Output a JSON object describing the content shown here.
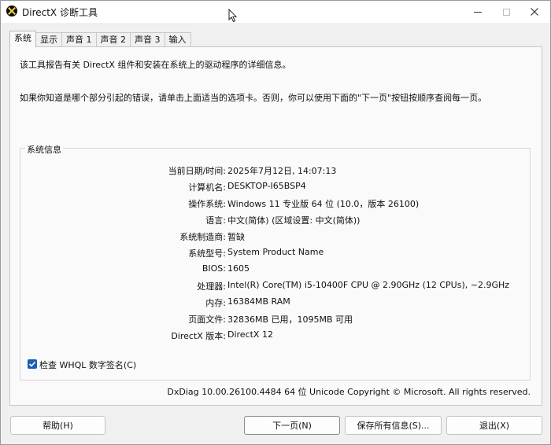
{
  "window": {
    "title": "DirectX 诊断工具"
  },
  "tabs": [
    {
      "label": "系统",
      "active": true
    },
    {
      "label": "显示"
    },
    {
      "label": "声音 1"
    },
    {
      "label": "声音 2"
    },
    {
      "label": "声音 3"
    },
    {
      "label": "输入"
    }
  ],
  "panel": {
    "intro_line1": "该工具报告有关 DirectX 组件和安装在系统上的驱动程序的详细信息。",
    "intro_line2": "如果你知道是哪个部分引起的错误，请单击上面适当的选项卡。否则，你可以使用下面的\"下一页\"按钮按顺序查阅每一页。",
    "group_title": "系统信息",
    "info": [
      {
        "label": "当前日期/时间:",
        "value": "2025年7月12日, 14:07:13"
      },
      {
        "label": "计算机名:",
        "value": "DESKTOP-I65BSP4"
      },
      {
        "label": "操作系统:",
        "value": "Windows 11 专业版 64 位 (10.0，版本 26100)"
      },
      {
        "label": "语言:",
        "value": "中文(简体) (区域设置: 中文(简体))"
      },
      {
        "label": "系统制造商:",
        "value": "暂缺"
      },
      {
        "label": "系统型号:",
        "value": "System Product Name"
      },
      {
        "label": "BIOS:",
        "value": "1605"
      },
      {
        "label": "处理器:",
        "value": "Intel(R) Core(TM) i5-10400F CPU @ 2.90GHz (12 CPUs), ~2.9GHz"
      },
      {
        "label": "内存:",
        "value": "16384MB RAM"
      },
      {
        "label": "页面文件:",
        "value": "32836MB 已用，1095MB 可用"
      },
      {
        "label": "DirectX 版本:",
        "value": "DirectX 12"
      }
    ],
    "whql_checkbox": {
      "label": "检查 WHQL 数字签名(C)",
      "checked": true
    },
    "footer": "DxDiag 10.00.26100.4484 64 位 Unicode  Copyright © Microsoft. All rights reserved."
  },
  "buttons": {
    "help": "帮助(H)",
    "next": "下一页(N)",
    "save": "保存所有信息(S)...",
    "exit": "退出(X)"
  },
  "colors": {
    "accent": "#1a5fb4",
    "background": "#f0f0f0",
    "panel": "#fafafa"
  }
}
